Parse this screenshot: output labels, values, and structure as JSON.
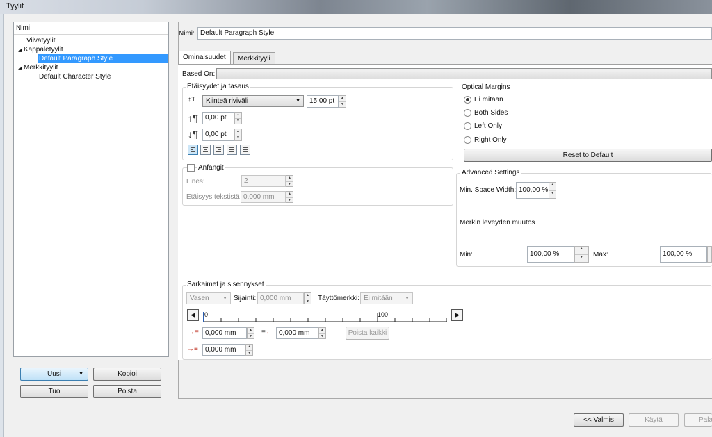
{
  "window": {
    "title": "Tyylit"
  },
  "tree": {
    "header": "Nimi",
    "items": [
      {
        "label": "Viivatyylit",
        "level": 1,
        "expanded": null,
        "selected": false
      },
      {
        "label": "Kappaletyylit",
        "level": 1,
        "expanded": true,
        "selected": false
      },
      {
        "label": "Default Paragraph Style",
        "level": 2,
        "expanded": null,
        "selected": true
      },
      {
        "label": "Merkkityylit",
        "level": 1,
        "expanded": true,
        "selected": false
      },
      {
        "label": "Default Character Style",
        "level": 2,
        "expanded": null,
        "selected": false
      }
    ]
  },
  "left_buttons": {
    "new": "Uusi",
    "copy": "Kopioi",
    "import": "Tuo",
    "delete": "Poista"
  },
  "name": {
    "label": "Nimi:",
    "value": "Default Paragraph Style"
  },
  "tabs": [
    {
      "label": "Ominaisuudet",
      "active": true
    },
    {
      "label": "Merkkityyli",
      "active": false
    }
  ],
  "based_on": {
    "label": "Based On:",
    "value": ""
  },
  "spacing": {
    "title": "Etäisyydet ja tasaus",
    "line_spacing_mode": "Kiinteä riviväli",
    "line_spacing_value": "15,00 pt",
    "space_above": "0,00 pt",
    "space_below": "0,00 pt"
  },
  "dropcaps": {
    "label": "Anfangit",
    "lines_label": "Lines:",
    "lines_value": "2",
    "distance_label": "Etäisyys tekstistä",
    "distance_value": "0,000 mm"
  },
  "optical_margins": {
    "title": "Optical Margins",
    "options": [
      "Ei mitään",
      "Both Sides",
      "Left Only",
      "Right Only"
    ],
    "selected": "Ei mitään",
    "reset": "Reset to Default"
  },
  "advanced": {
    "title": "Advanced Settings",
    "min_space_label": "Min. Space Width:",
    "min_space_value": "100,00 %",
    "glyph_label": "Merkin leveyden muutos",
    "min_label": "Min:",
    "min_value": "100,00 %",
    "max_label": "Max:",
    "max_value": "100,00 %"
  },
  "tabs_section": {
    "title": "Sarkaimet ja sisennykset",
    "align_value": "Vasen",
    "position_label": "Sijainti:",
    "position_value": "0,000 mm",
    "fill_label": "Täyttömerkki:",
    "fill_value": "Ei mitään",
    "ruler_start": "0",
    "ruler_mid": "100",
    "first_indent": "0,000 mm",
    "right_indent": "0,000 mm",
    "clear_all": "Poista kaikki",
    "left_indent": "0,000 mm"
  },
  "bottom_buttons": {
    "done": "<< Valmis",
    "apply": "Käytä",
    "revert": "Palau"
  }
}
